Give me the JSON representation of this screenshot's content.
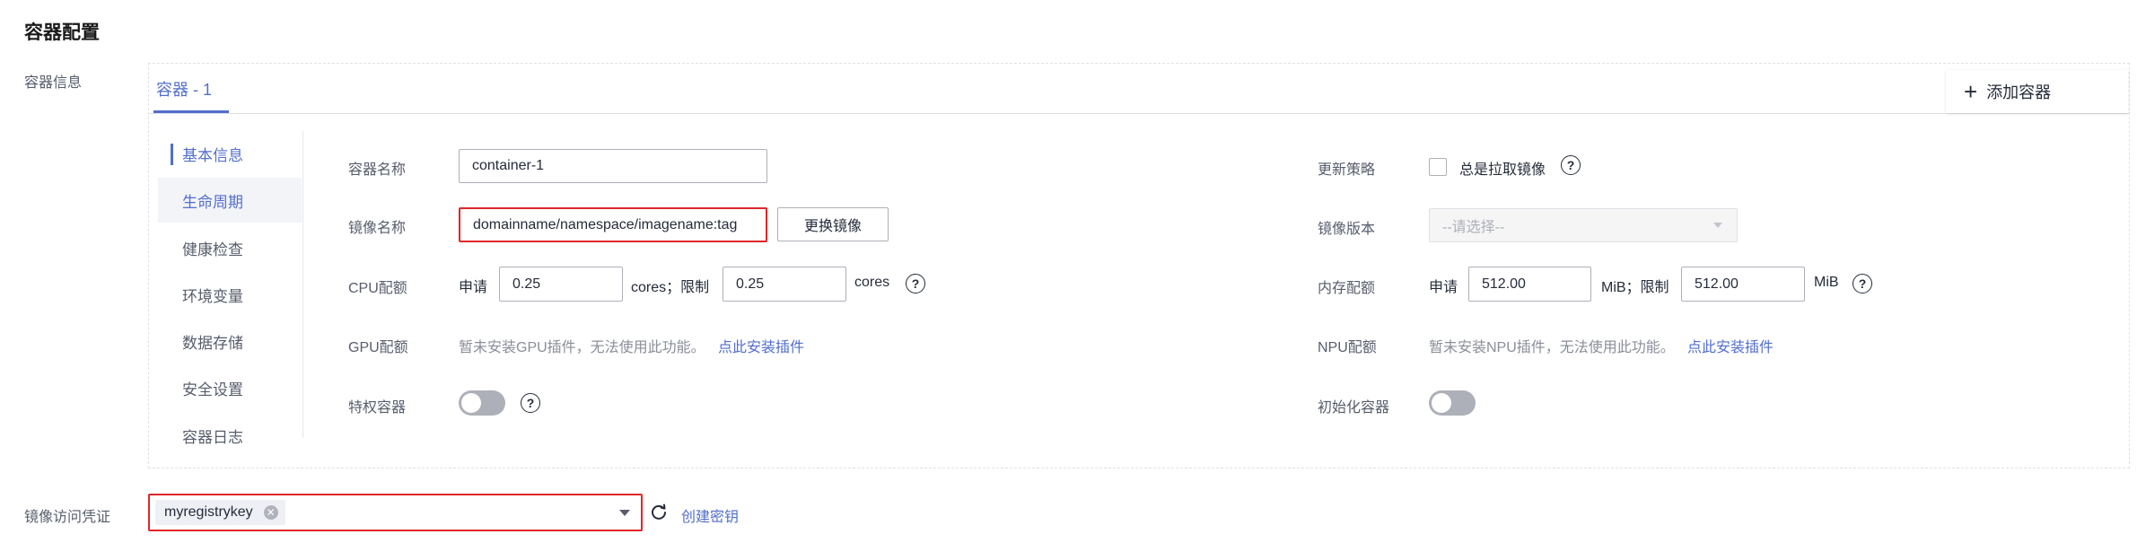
{
  "page": {
    "title": "容器配置",
    "container_info_label": "容器信息",
    "registry_credential_label": "镜像访问凭证"
  },
  "tabs": {
    "active": "容器 - 1",
    "add_button": "添加容器"
  },
  "subnav": [
    "基本信息",
    "生命周期",
    "健康检查",
    "环境变量",
    "数据存储",
    "安全设置",
    "容器日志"
  ],
  "form": {
    "container_name": {
      "label": "容器名称",
      "value": "container-1"
    },
    "image_name": {
      "label": "镜像名称",
      "value": "domainname/namespace/imagename:tag",
      "change_button": "更换镜像"
    },
    "cpu": {
      "label": "CPU配额",
      "request_label": "申请",
      "request_value": "0.25",
      "request_unit": "cores；限制",
      "limit_value": "0.25",
      "limit_unit": "cores"
    },
    "gpu": {
      "label": "GPU配额",
      "note": "暂未安装GPU插件，无法使用此功能。",
      "link": "点此安装插件"
    },
    "privileged": {
      "label": "特权容器",
      "on": false
    },
    "update_policy": {
      "label": "更新策略",
      "checkbox_label": "总是拉取镜像",
      "checked": false
    },
    "image_version": {
      "label": "镜像版本",
      "placeholder": "--请选择--"
    },
    "memory": {
      "label": "内存配额",
      "request_label": "申请",
      "request_value": "512.00",
      "request_unit": "MiB；限制",
      "limit_value": "512.00",
      "limit_unit": "MiB"
    },
    "npu": {
      "label": "NPU配额",
      "note": "暂未安装NPU插件，无法使用此功能。",
      "link": "点此安装插件"
    },
    "init_container": {
      "label": "初始化容器",
      "on": false
    }
  },
  "registry": {
    "selected_tag": "myregistrykey",
    "create_link": "创建密钥"
  },
  "icons": {
    "help": "question-circle-icon",
    "refresh": "refresh-icon",
    "add": "plus-icon",
    "close": "close-circle-icon",
    "dropdown": "caret-down-icon"
  },
  "colors": {
    "accent": "#526ecc",
    "highlight_border": "#e0262a",
    "toggle_off": "#adb0b8"
  }
}
